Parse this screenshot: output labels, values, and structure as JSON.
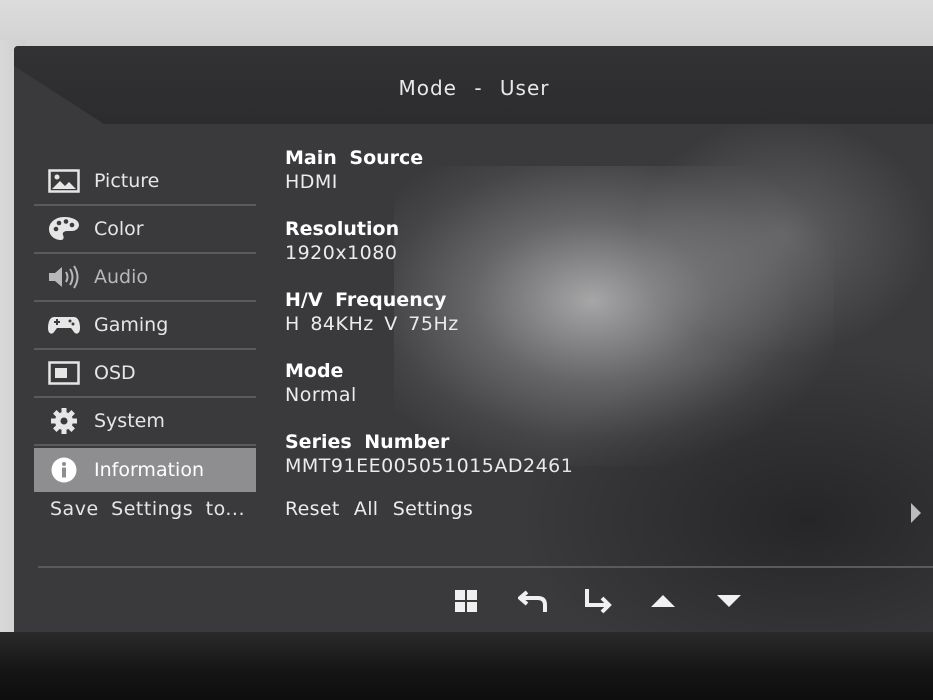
{
  "header": {
    "title": "Mode  -  User"
  },
  "sidebar": {
    "items": [
      {
        "label": "Picture",
        "icon": "picture-icon"
      },
      {
        "label": "Color",
        "icon": "palette-icon"
      },
      {
        "label": "Audio",
        "icon": "speaker-icon"
      },
      {
        "label": "Gaming",
        "icon": "gamepad-icon"
      },
      {
        "label": "OSD",
        "icon": "osd-window-icon"
      },
      {
        "label": "System",
        "icon": "gear-icon"
      },
      {
        "label": "Information",
        "icon": "info-icon",
        "selected": true
      }
    ],
    "save_label": "Save  Settings  to..."
  },
  "info": {
    "main_source": {
      "label": "Main  Source",
      "value": "HDMI"
    },
    "resolution": {
      "label": "Resolution",
      "value": "1920x1080"
    },
    "hv_frequency": {
      "label": "H/V  Frequency",
      "value": "H  84KHz  V  75Hz"
    },
    "mode": {
      "label": "Mode",
      "value": "Normal"
    },
    "series_number": {
      "label": "Series  Number",
      "value": "MMT91EE005051015AD2461"
    }
  },
  "reset": {
    "label": "Reset  All  Settings"
  },
  "nav_buttons": [
    "menu-grid-icon",
    "back-icon",
    "enter-icon",
    "up-arrow-icon",
    "down-arrow-icon"
  ],
  "colors": {
    "selected": "#8e8e90",
    "panel": "#3a3a3d",
    "text": "#e6e6e6"
  }
}
